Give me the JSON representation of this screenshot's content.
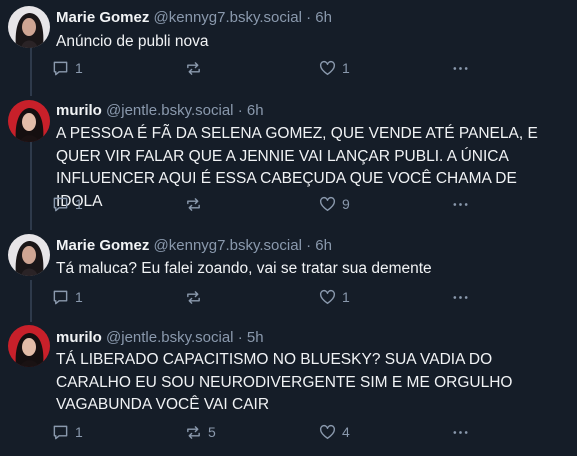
{
  "posts": [
    {
      "author_name": "Marie Gomez",
      "author_handle": "@kennyg7.bsky.social",
      "separator": "·",
      "time": "6h",
      "text": "Anúncio de publi nova",
      "replies": "1",
      "reposts": "",
      "likes": "1"
    },
    {
      "author_name": "murilo",
      "author_handle": "@jentle.bsky.social",
      "separator": "·",
      "time": "6h",
      "text": "A PESSOA É FÃ DA SELENA GOMEZ, QUE VENDE ATÉ PANELA, E QUER VIR FALAR QUE A JENNIE VAI LANÇAR PUBLI. A ÚNICA INFLUENCER AQUI É ESSA CABEÇUDA QUE VOCÊ CHAMA DE IDOLA",
      "replies": "1",
      "reposts": "",
      "likes": "9"
    },
    {
      "author_name": "Marie Gomez",
      "author_handle": "@kennyg7.bsky.social",
      "separator": "·",
      "time": "6h",
      "text": "Tá maluca? Eu falei zoando, vai se tratar sua demente",
      "replies": "1",
      "reposts": "",
      "likes": "1"
    },
    {
      "author_name": "murilo",
      "author_handle": "@jentle.bsky.social",
      "separator": "·",
      "time": "5h",
      "text": "TÁ LIBERADO CAPACITISMO NO BLUESKY? SUA VADIA DO CARALHO EU SOU NEURODIVERGENTE SIM E ME ORGULHO VAGABUNDA VOCÊ VAI CAIR",
      "replies": "1",
      "reposts": "5",
      "likes": "4"
    }
  ],
  "icons": {
    "reply": "reply-icon",
    "repost": "repost-icon",
    "like": "heart-icon",
    "more": "more-icon"
  },
  "colors": {
    "background": "#151d28",
    "text": "#f1f3f5",
    "muted": "#8a99ad",
    "thread_line": "#2e3a4b"
  }
}
